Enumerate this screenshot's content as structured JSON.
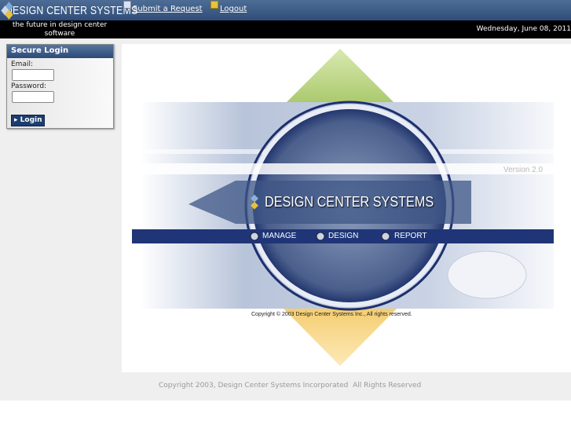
{
  "header": {
    "brand": "DESIGN CENTER SYSTEMS",
    "links": [
      {
        "label": "Submit a Request",
        "icon": "edit-icon"
      },
      {
        "label": "Logout",
        "icon": "key-icon"
      }
    ],
    "tagline": "the future in design center software",
    "date": "Wednesday, June 08, 2011"
  },
  "login": {
    "title": "Secure Login",
    "email_label": "Email:",
    "email_value": "",
    "password_label": "Password:",
    "password_value": "",
    "button": "Login"
  },
  "splash": {
    "title": "DESIGN CENTER SYSTEMS",
    "version": "Version 2.0",
    "nav": [
      "MANAGE",
      "DESIGN",
      "REPORT"
    ],
    "copyright": "Copyright © 2003 Design Center Systems Inc., All rights reserved."
  },
  "footer": {
    "copyright": "Copyright 2003, Design Center Systems Incorporated  All Rights Reserved"
  },
  "colors": {
    "header": "#2f4d78",
    "accent_yellow": "#f2c94c",
    "accent_green": "#b6d07a"
  }
}
